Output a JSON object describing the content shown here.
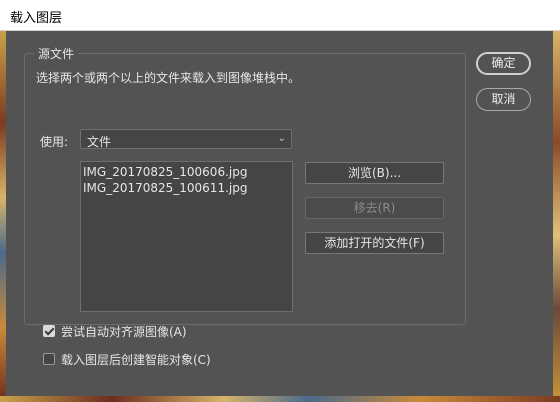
{
  "window": {
    "title": "载入图层"
  },
  "source": {
    "group_title": "源文件",
    "description": "选择两个或两个以上的文件来载入到图像堆栈中。",
    "use_label": "使用:",
    "use_value": "文件",
    "files": [
      "IMG_20170825_100606.jpg",
      "IMG_20170825_100611.jpg"
    ],
    "browse_label": "浏览(B)...",
    "remove_label": "移去(R)",
    "add_open_label": "添加打开的文件(F)"
  },
  "actions": {
    "ok_label": "确定",
    "cancel_label": "取消"
  },
  "options": {
    "auto_align_label": "尝试自动对齐源图像(A)",
    "auto_align_checked": true,
    "smart_object_label": "载入图层后创建智能对象(C)",
    "smart_object_checked": false
  }
}
